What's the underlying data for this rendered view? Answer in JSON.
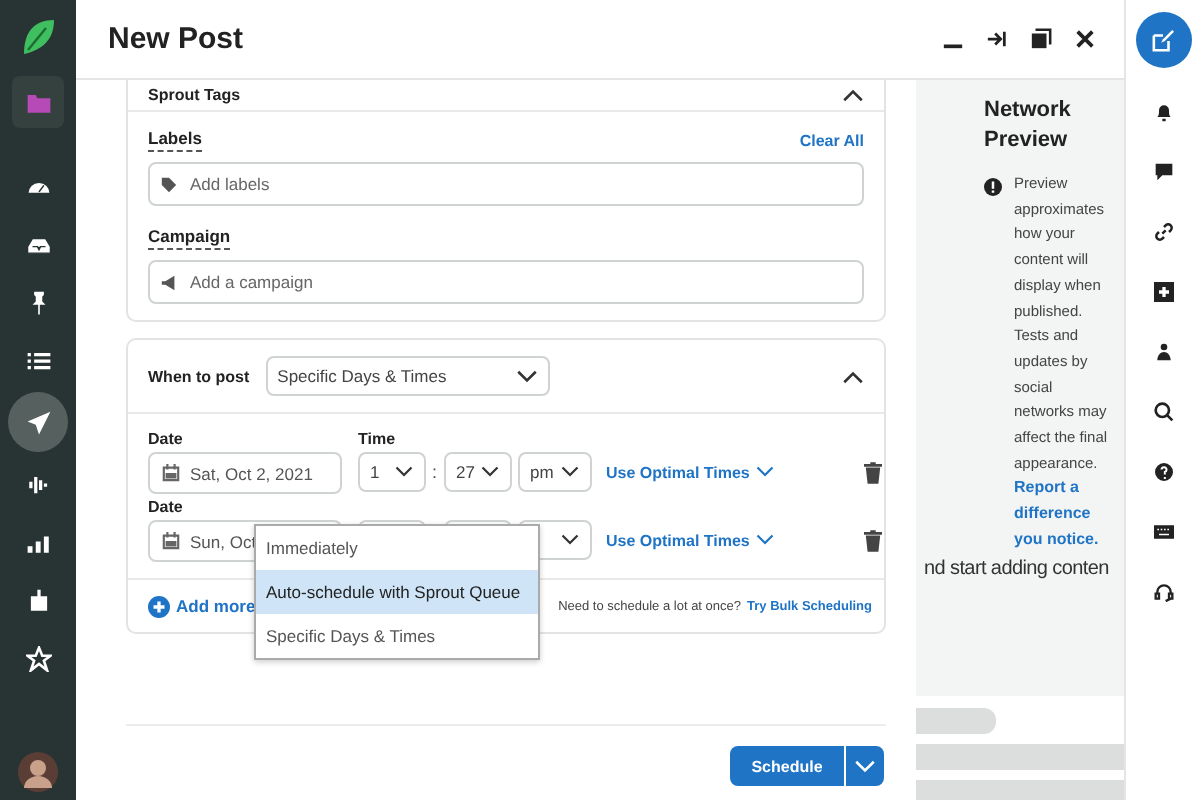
{
  "nav": [
    {
      "selected": false
    },
    {
      "selected": false
    },
    {
      "selected": false
    },
    {
      "selected": false
    },
    {
      "selected": false
    },
    {
      "selected": true
    },
    {
      "selected": false
    },
    {
      "selected": false
    },
    {
      "selected": false
    },
    {
      "selected": false
    }
  ],
  "window": {
    "title": "New Post"
  },
  "tags_card": {
    "title": "Sprout Tags",
    "labels_label": "Labels",
    "clear_all": "Clear All",
    "labels_placeholder": "Add labels",
    "campaign_label": "Campaign",
    "campaign_placeholder": "Add a campaign"
  },
  "when_card": {
    "label": "When to post",
    "value": "Specific Days & Times",
    "rows": [
      {
        "date_label": "Date",
        "date": "Sat, Oct 2, 2021",
        "time_label": "Time",
        "hour": "1",
        "colon": ":",
        "minute": "27",
        "ampm": "pm",
        "optimal": "Use Optimal Times"
      },
      {
        "date_label": "Date",
        "date": "Sun, Oct",
        "optimal": "Use Optimal Times"
      }
    ],
    "add_more": "Add more",
    "bulk_note": "Need to schedule a lot at once?",
    "bulk_link": "Try Bulk Scheduling"
  },
  "menu": [
    {
      "label": "Immediately",
      "selected": false
    },
    {
      "label": "Auto-schedule with Sprout Queue",
      "selected": true
    },
    {
      "label": "Specific Days & Times",
      "selected": false
    }
  ],
  "preview": {
    "title": "Network Preview",
    "note": "Preview approximates how your content will display when published. Tests and updates by social networks may affect the final appearance.",
    "report": "Report a difference you notice.",
    "background_text": "nd start adding conten"
  },
  "schedule_button": "Schedule"
}
